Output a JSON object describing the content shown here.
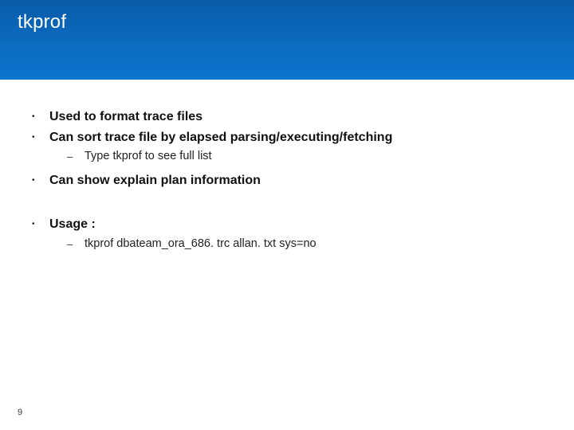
{
  "title": "tkprof",
  "bullets": {
    "b1": "Used to format trace files",
    "b2": "Can sort trace file by elapsed parsing/executing/fetching",
    "b2sub": "Type tkprof to see full list",
    "b3": "Can show explain plan information",
    "b4": "Usage :",
    "b4sub": "tkprof dbateam_ora_686. trc allan. txt sys=no"
  },
  "glyphs": {
    "dot": "•",
    "dash": "–"
  },
  "page": "9"
}
